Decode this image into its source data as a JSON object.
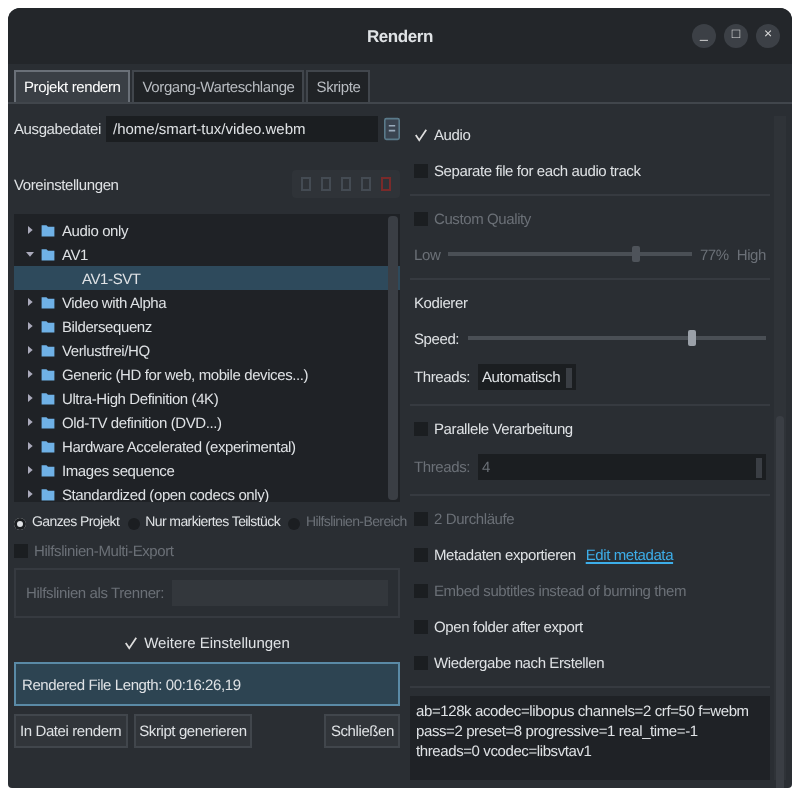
{
  "window": {
    "title": "Rendern",
    "controls": [
      "_",
      "□",
      "×"
    ]
  },
  "tabs": [
    {
      "label": "Projekt rendern",
      "selected": true
    },
    {
      "label": "Vorgang-Warteschlange",
      "selected": false
    },
    {
      "label": "Skripte",
      "selected": false
    }
  ],
  "output_file": {
    "label": "Ausgabedatei",
    "value": "/home/smart-tux/video.webm"
  },
  "presets": {
    "label": "Voreinstellungen",
    "tree": [
      {
        "label": "Audio only",
        "expanded": false,
        "selected": false
      },
      {
        "label": "AV1",
        "expanded": true,
        "selected": false,
        "children": [
          {
            "label": "AV1-SVT",
            "selected": true
          }
        ]
      },
      {
        "label": "Video with Alpha",
        "expanded": false,
        "selected": false
      },
      {
        "label": "Bildersequenz",
        "expanded": false,
        "selected": false
      },
      {
        "label": "Verlustfrei/HQ",
        "expanded": false,
        "selected": false
      },
      {
        "label": "Generic (HD for web, mobile devices...)",
        "expanded": false,
        "selected": false
      },
      {
        "label": "Ultra-High Definition (4K)",
        "expanded": false,
        "selected": false
      },
      {
        "label": "Old-TV definition (DVD...)",
        "expanded": false,
        "selected": false
      },
      {
        "label": "Hardware Accelerated (experimental)",
        "expanded": false,
        "selected": false
      },
      {
        "label": "Images sequence",
        "expanded": false,
        "selected": false
      },
      {
        "label": "Standardized (open codecs only)",
        "expanded": false,
        "selected": false
      }
    ]
  },
  "range": [
    {
      "label": "Ganzes Projekt",
      "selected": true,
      "disabled": false
    },
    {
      "label": "Nur markiertes Teilstück",
      "selected": false,
      "disabled": false
    },
    {
      "label": "Hilfslinien-Bereich",
      "selected": false,
      "disabled": true
    }
  ],
  "guides_multi_export": {
    "label": "Hilfslinien-Multi-Export",
    "checked": false,
    "disabled": true
  },
  "guides_separator": {
    "label": "Hilfslinien als Trenner:",
    "disabled": true
  },
  "more_settings": {
    "label": "Weitere Einstellungen",
    "checked": true
  },
  "rendered_length": "Rendered File Length: 00:16:26,19",
  "buttons": [
    "In Datei rendern",
    "Skript generieren",
    "Schließen"
  ],
  "option_groups": [
    [
      {
        "kind": "check",
        "label": "Audio",
        "checked": true,
        "disabled": false
      },
      {
        "kind": "check",
        "label": "Separate file for each audio track",
        "checked": false,
        "disabled": false
      }
    ],
    [
      {
        "kind": "check",
        "label": "Custom Quality",
        "checked": false,
        "disabled": true
      },
      {
        "kind": "slider",
        "low": "Low",
        "reading": "77%",
        "high": "High",
        "level": 0.77,
        "disabled": true
      }
    ],
    [
      {
        "kind": "heading",
        "label": "Kodierer"
      },
      {
        "kind": "slider",
        "label": "Speed:",
        "level": 0.75,
        "disabled": false
      },
      {
        "kind": "spin",
        "label": "Threads:",
        "value": "Automatisch",
        "disabled": false
      }
    ],
    [
      {
        "kind": "check",
        "label": "Parallele Verarbeitung",
        "checked": false,
        "disabled": false
      },
      {
        "kind": "spin",
        "label": "Threads:",
        "value": "4",
        "disabled": true
      }
    ],
    [
      {
        "kind": "check",
        "label": "2 Durchläufe",
        "checked": false,
        "disabled": true
      },
      {
        "kind": "check",
        "label": "Metadaten exportieren",
        "link": "Edit metadata",
        "checked": false,
        "disabled": false
      },
      {
        "kind": "check",
        "label": "Embed subtitles instead of burning them",
        "checked": false,
        "disabled": true
      },
      {
        "kind": "check",
        "label": "Open folder after export",
        "checked": false,
        "disabled": false
      },
      {
        "kind": "check",
        "label": "Wiedergabe nach Erstellen",
        "checked": false,
        "disabled": false
      }
    ]
  ],
  "params": "ab=128k acodec=libopus channels=2 crf=50 f=webm pass=2 preset=8 progressive=1 real_time=-1 threads=0 vcodec=libsvtav1"
}
